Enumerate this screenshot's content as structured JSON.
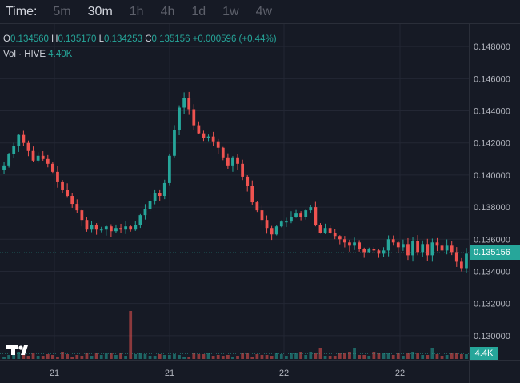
{
  "toolbar": {
    "time_label": "Time:",
    "timeframes": [
      "5m",
      "30m",
      "1h",
      "4h",
      "1d",
      "1w",
      "4w"
    ],
    "active": "30m"
  },
  "legend": {
    "open_key": "O",
    "open": "0.134560",
    "high_key": "H",
    "high": "0.135170",
    "low_key": "L",
    "low": "0.134253",
    "close_key": "C",
    "close": "0.135156",
    "change": "+0.000596 (+0.44%)",
    "vol_key": "Vol · HIVE",
    "vol": "4.40K"
  },
  "price_tag": "0.135156",
  "vol_tag": "4.4K",
  "colors": {
    "up": "#26a69a",
    "down": "#ef5350",
    "background": "#161a25",
    "grid": "#232734"
  },
  "chart_data": {
    "type": "candlestick",
    "y_ticks": [
      "0.148000",
      "0.146000",
      "0.144000",
      "0.142000",
      "0.140000",
      "0.138000",
      "0.136000",
      "0.134000",
      "0.132000",
      "0.130000"
    ],
    "ylim": [
      0.1285,
      0.1494
    ],
    "x_ticks": [
      "21",
      "21",
      "22",
      "22"
    ],
    "last_price": 0.135156,
    "closes": [
      0.1406,
      0.1413,
      0.1418,
      0.1425,
      0.142,
      0.1415,
      0.1409,
      0.1412,
      0.141,
      0.1407,
      0.1402,
      0.1396,
      0.1391,
      0.1387,
      0.1382,
      0.1378,
      0.1372,
      0.1366,
      0.1369,
      0.1366,
      0.1366,
      0.1368,
      0.1365,
      0.1367,
      0.1366,
      0.1368,
      0.1366,
      0.1369,
      0.1375,
      0.1379,
      0.1384,
      0.1389,
      0.1387,
      0.1395,
      0.1412,
      0.1428,
      0.1442,
      0.1448,
      0.1441,
      0.1431,
      0.1426,
      0.1423,
      0.1424,
      0.1421,
      0.1417,
      0.1411,
      0.1406,
      0.1411,
      0.1407,
      0.1399,
      0.1393,
      0.1383,
      0.1378,
      0.1372,
      0.1367,
      0.1363,
      0.1368,
      0.1371,
      0.1371,
      0.1374,
      0.1376,
      0.1374,
      0.1378,
      0.138,
      0.1369,
      0.1364,
      0.1367,
      0.1364,
      0.1362,
      0.136,
      0.1358,
      0.1356,
      0.1358,
      0.1354,
      0.1352,
      0.1354,
      0.1353,
      0.1351,
      0.1353,
      0.136,
      0.1358,
      0.1355,
      0.1357,
      0.135,
      0.1359,
      0.1352,
      0.1357,
      0.135,
      0.1358,
      0.1356,
      0.1353,
      0.1356,
      0.1352,
      0.1346,
      0.1342,
      0.1351
    ],
    "volume_bars": 96,
    "volume_spike_value_k": 105
  }
}
